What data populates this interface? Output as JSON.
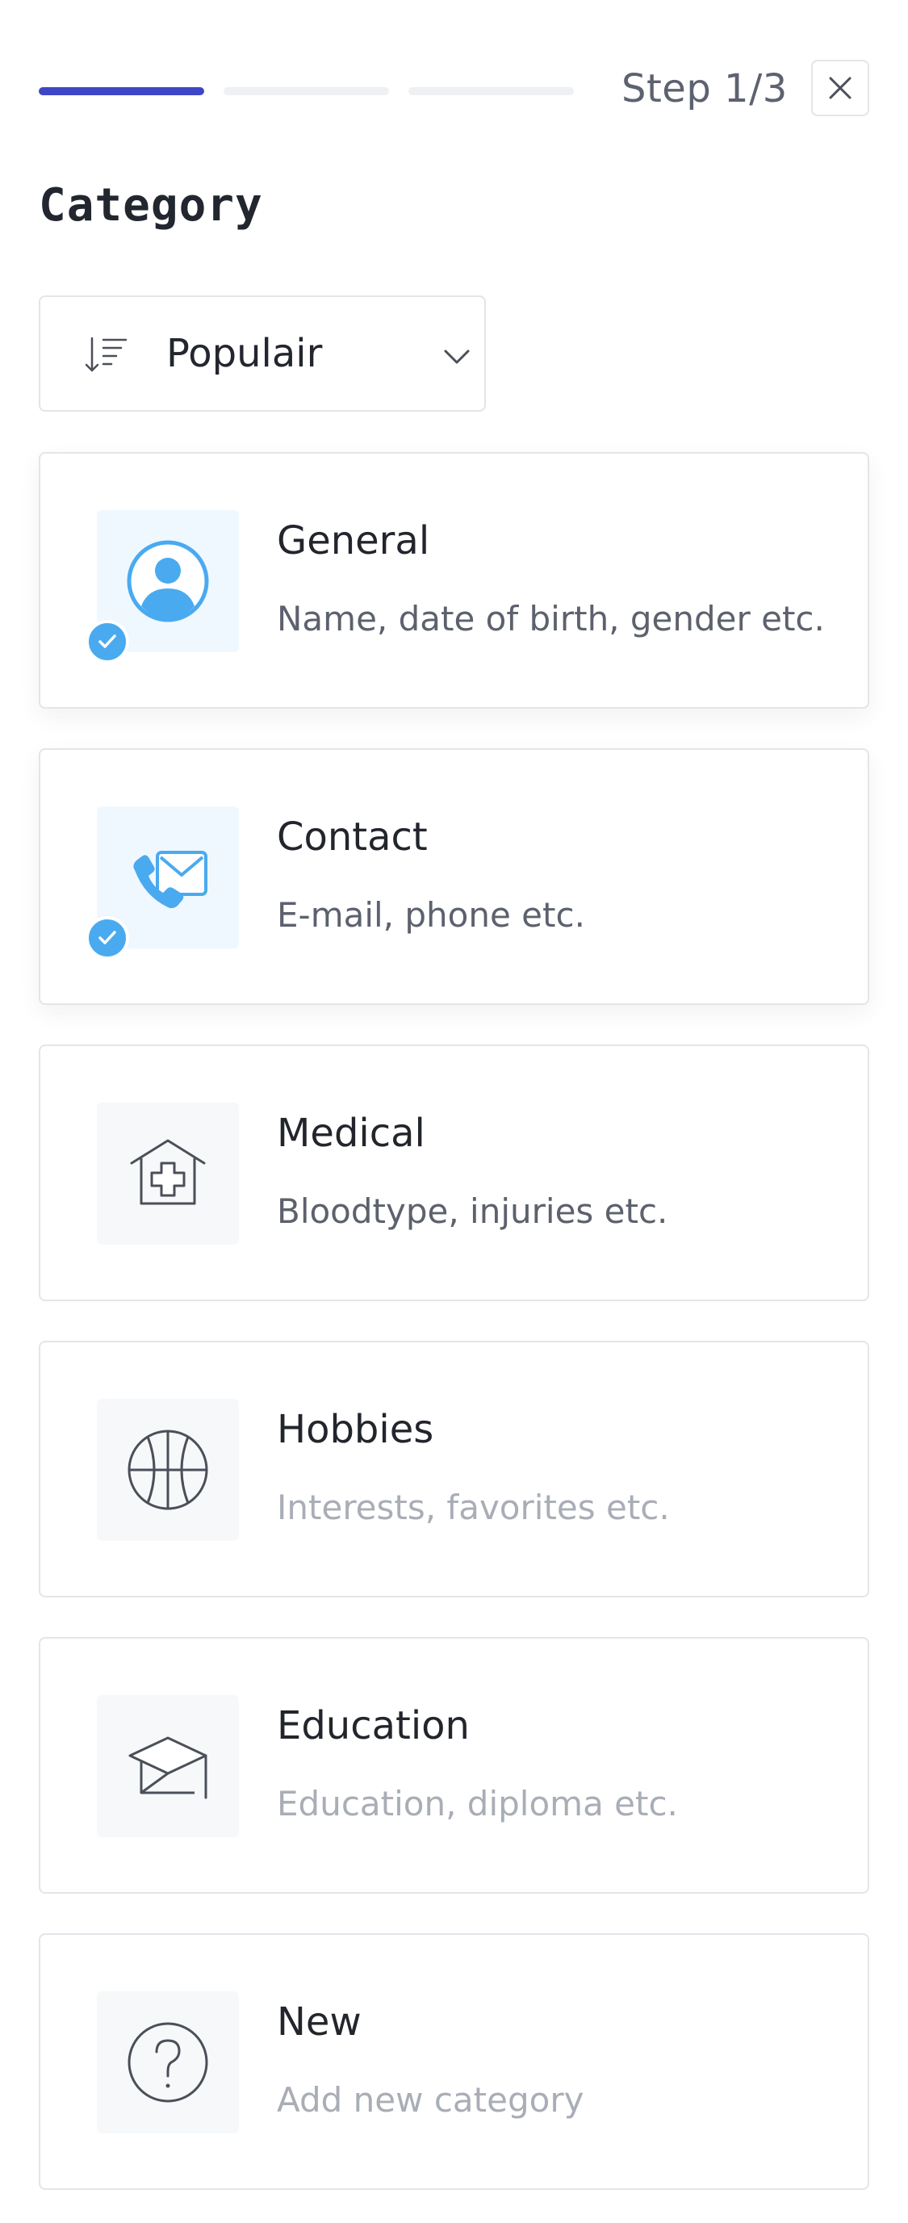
{
  "header": {
    "step_label": "Step 1/3",
    "progress": {
      "current_step": 1,
      "total_steps": 3
    },
    "close_icon": "close-icon",
    "accent_color": "#3f46c5"
  },
  "page": {
    "title": "Category"
  },
  "sort": {
    "icon": "sort-descending-icon",
    "selected": "Populair",
    "chevron_icon": "chevron-down-icon"
  },
  "categories": [
    {
      "title": "General",
      "description": "Name, date of birth, gender etc.",
      "icon": "user-circle-icon",
      "selected": true
    },
    {
      "title": "Contact",
      "description": "E-mail, phone etc.",
      "icon": "phone-mail-icon",
      "selected": true
    },
    {
      "title": "Medical",
      "description": "Bloodtype, injuries etc.",
      "icon": "medical-house-icon",
      "selected": false
    },
    {
      "title": "Hobbies",
      "description": "Interests, favorites etc.",
      "icon": "basketball-icon",
      "selected": false
    },
    {
      "title": "Education",
      "description": "Education, diploma etc.",
      "icon": "graduation-cap-icon",
      "selected": false
    },
    {
      "title": "New",
      "description": "Add new category",
      "icon": "question-circle-icon",
      "selected": false
    }
  ],
  "colors": {
    "selected_icon": "#4aaaf0",
    "check_badge": "#4aaaf0",
    "unselected_icon": "#4b4f58"
  }
}
